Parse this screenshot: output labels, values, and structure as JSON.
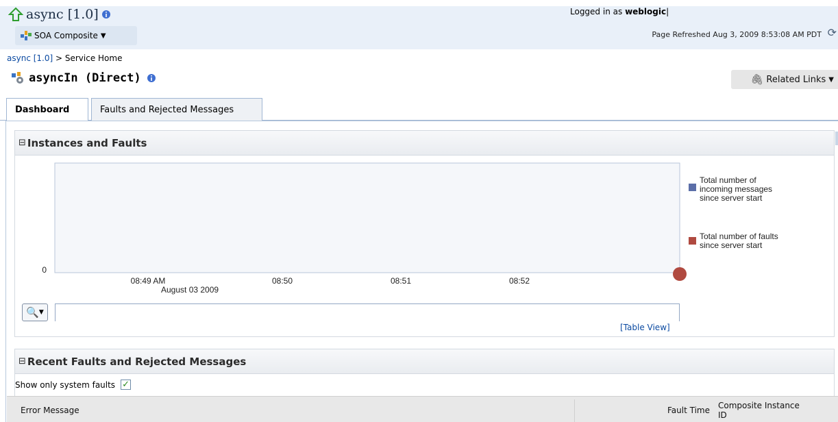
{
  "header": {
    "app_title": "async [1.0]",
    "soa_menu_label": "SOA Composite",
    "logged_in_prefix": "Logged in as",
    "logged_in_user": "weblogic",
    "page_refreshed": "Page Refreshed Aug 3, 2009 8:53:08 AM PDT"
  },
  "breadcrumb": {
    "link": "async [1.0]",
    "separator": " > ",
    "current": "Service Home"
  },
  "service": {
    "name": "asyncIn (Direct)",
    "related_links": "Related Links"
  },
  "tabs": [
    {
      "label": "Dashboard",
      "active": true
    },
    {
      "label": "Faults and Rejected Messages",
      "active": false
    }
  ],
  "instances_panel": {
    "title": "Instances and Faults",
    "table_view_link": "[Table View]"
  },
  "chart_data": {
    "type": "line",
    "x": [
      "08:49 AM",
      "08:50",
      "08:51",
      "08:52"
    ],
    "x_sublabel": "August 03 2009",
    "y_ticks": [
      0
    ],
    "series": [
      {
        "name": "Total number of incoming messages since server start",
        "color": "#5b6ea8",
        "values": []
      },
      {
        "name": "Total number of faults since server start",
        "color": "#b04a40",
        "values": [
          0
        ]
      }
    ],
    "legend": "right"
  },
  "recent_panel": {
    "title": "Recent Faults and Rejected Messages",
    "show_system_faults_label": "Show only system faults",
    "show_system_faults_checked": true,
    "columns": [
      "Error Message",
      "Fault Time",
      "Composite Instance ID"
    ]
  }
}
